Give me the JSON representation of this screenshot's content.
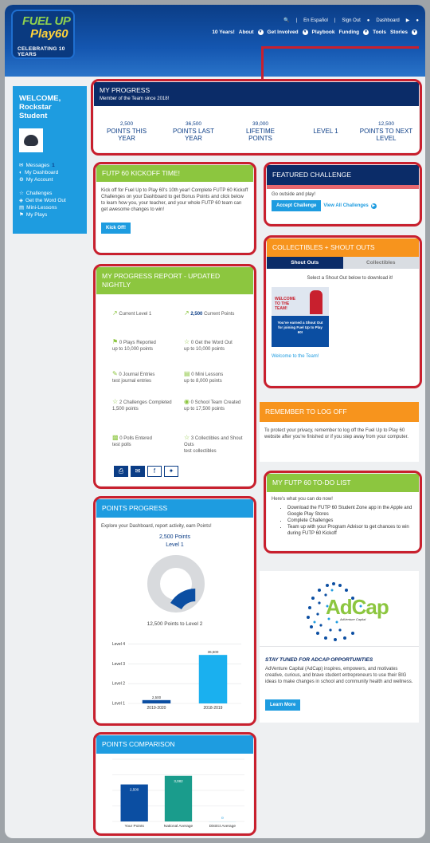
{
  "header": {
    "logo": {
      "line1": "FUEL UP",
      "line2": "Play60",
      "tagline": "CELEBRATING 10 YEARS"
    },
    "top": {
      "search_icon": "search-icon",
      "lang": "En Español",
      "sign_out": "Sign Out",
      "dashboard": "Dashboard"
    },
    "nav": [
      "10 Years!",
      "About",
      "Get Involved",
      "Playbook",
      "Funding",
      "Tools",
      "Stories"
    ]
  },
  "sidebar": {
    "welcome_1": "WELCOME,",
    "welcome_2": "Rockstar Student",
    "items": [
      {
        "icon": "envelope-icon",
        "label": "Messages",
        "badge": "1"
      },
      {
        "icon": "speedometer-icon",
        "label": "My Dashboard"
      },
      {
        "icon": "gear-icon",
        "label": "My Account"
      },
      {
        "icon": "trophy-icon",
        "label": "Challenges"
      },
      {
        "icon": "megaphone-icon",
        "label": "Get the Word Out"
      },
      {
        "icon": "book-icon",
        "label": "Mini-Lessons"
      },
      {
        "icon": "flag-icon",
        "label": "My Plays"
      }
    ]
  },
  "progress": {
    "title": "MY PROGRESS",
    "subtitle": "Member of the Team since 2018!",
    "stats": [
      {
        "num": "2,500",
        "label": "POINTS THIS YEAR"
      },
      {
        "num": "36,500",
        "label": "POINTS LAST YEAR"
      },
      {
        "num": "39,000",
        "label": "LIFETIME POINTS"
      },
      {
        "num": "",
        "label": "LEVEL 1"
      },
      {
        "num": "12,500",
        "label": "POINTS TO NEXT LEVEL"
      }
    ]
  },
  "kickoff": {
    "title": "FUTP 60 KICKOFF TIME!",
    "body": "Kick off for Fuel Up to Play 60's 10th year! Complete FUTP 60 Kickoff Challenges on your Dashboard to get Bonus Points and click below to learn how you, your teacher, and your whole FUTP 60 team can get awesome changes to win!",
    "button": "Kick Off!"
  },
  "featured": {
    "title": "FEATURED CHALLENGE",
    "text": "Go outside and play!",
    "accept": "Accept Challenge",
    "view_all": "View All Challenges"
  },
  "collectibles": {
    "title": "COLLECTIBLES + SHOUT OUTS",
    "tab_active": "Shout Outs",
    "tab_inactive": "Collectibles",
    "hint": "Select a Shout Out below to download it!",
    "card_title": "WELCOME TO THE TEAM!",
    "card_text": "You've earned a Shout Out for joining Fuel Up to Play 60!",
    "link": "Welcome to the Team!"
  },
  "report": {
    "title": "MY PROGRESS REPORT - UPDATED NIGHTLY",
    "items": [
      {
        "num": "",
        "text": "Current Level 1",
        "sub": ""
      },
      {
        "num": "2,500",
        "text": "Current Points",
        "sub": ""
      },
      {
        "num": "0",
        "text": "Plays Reported",
        "sub": "up to 10,000 points"
      },
      {
        "num": "0",
        "text": "Get the Word Out",
        "sub": "up to 10,000 points"
      },
      {
        "num": "0",
        "text": "Journal Entries",
        "sub": "test journal entries"
      },
      {
        "num": "0",
        "text": "Mini Lessons",
        "sub": "up to 8,000 points"
      },
      {
        "num": "2",
        "text": "Challenges Completed",
        "sub": "1,500 points"
      },
      {
        "num": "0",
        "text": "School Team Created",
        "sub": "up to 17,500 points"
      },
      {
        "num": "0",
        "text": "Polls Entered",
        "sub": "test polls"
      },
      {
        "num": "3",
        "text": "Collectibles and Shout Outs",
        "sub": "test collectibles"
      }
    ]
  },
  "logoff": {
    "title": "REMEMBER TO LOG OFF",
    "text": "To protect your privacy, remember to log off the Fuel Up to Play 60 website after you're finished or if you step away from your computer."
  },
  "todo": {
    "title": "MY FUTP 60 TO-DO LIST",
    "intro": "Here's what you can do now!",
    "items": [
      "Download the FUTP 60 Student Zone app in the Apple and Google Play Stores",
      "Complete Challenges",
      "Team up with your Program Advisor to get chances to win during FUTP 60 Kickoff"
    ]
  },
  "points_progress": {
    "title": "POINTS PROGRESS",
    "intro": "Explore your Dashboard, report activity, earn Points!",
    "points": "2,500 Points",
    "level": "Level 1",
    "to_next": "12,500 Points to Level 2"
  },
  "adcap": {
    "logo_text": "AdCap",
    "logo_sub": "AdVenture Capital",
    "heading": "STAY TUNED FOR ADCAP OPPORTUNITIES",
    "text": "AdVenture Capital (AdCap) inspires, empowers, and motivates creative, curious, and brave student entrepreneurs to use their BIG ideas to make changes in school and community health and wellness.",
    "button": "Learn More"
  },
  "comparison": {
    "title": "POINTS COMPARISON"
  },
  "chart_data": [
    {
      "type": "bar",
      "categories": [
        "2019-2020",
        "2018-2019"
      ],
      "values": [
        2500,
        36500
      ],
      "y_tick_labels": [
        "Level 1",
        "Level 2",
        "Level 3",
        "Level 4"
      ],
      "colors": [
        "#0b4ea2",
        "#1ab0ef"
      ]
    },
    {
      "type": "bar",
      "categories": [
        "Your Points",
        "National Average",
        "District Average"
      ],
      "values": [
        2500,
        3082,
        0
      ],
      "colors": [
        "#0b4ea2",
        "#1a9c8c",
        "#1e9ce0"
      ]
    }
  ]
}
